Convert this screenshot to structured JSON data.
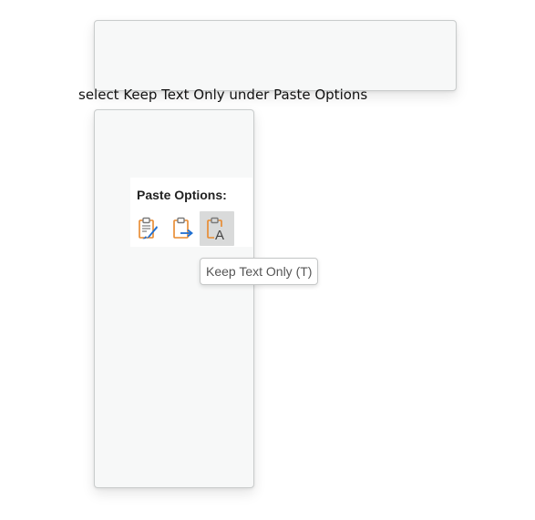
{
  "instruction": "select Keep Text Only under Paste Options",
  "paste_options": {
    "title": "Paste Options:",
    "buttons": [
      {
        "icon": "keep-source-formatting-icon",
        "selected": false
      },
      {
        "icon": "merge-formatting-icon",
        "selected": false
      },
      {
        "icon": "keep-text-only-icon",
        "selected": true,
        "glyph": "A"
      }
    ]
  },
  "tooltip": {
    "text": "Keep Text Only (T)"
  },
  "colors": {
    "clipboard_orange": "#e8892c",
    "accent_blue": "#1f6fd1",
    "selected_bg": "#d9dada",
    "panel_bg": "#f7f8f8"
  }
}
